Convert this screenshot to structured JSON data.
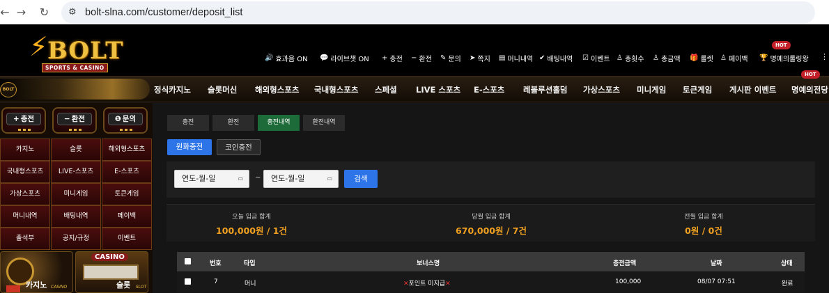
{
  "browser": {
    "url": "bolt-slna.com/customer/deposit_list"
  },
  "logo": {
    "name": "BOLT",
    "tagline": "SPORTS & CASINO"
  },
  "utility": [
    {
      "label": "효과음 ON",
      "icon": "speaker-icon",
      "glyph": "🔊"
    },
    {
      "label": "라이브챗 ON",
      "icon": "chat-icon",
      "glyph": "💬"
    },
    {
      "label": "충전",
      "icon": "plus-icon",
      "glyph": "+"
    },
    {
      "label": "환전",
      "icon": "minus-icon",
      "glyph": "−"
    },
    {
      "label": "문의",
      "icon": "edit-icon",
      "glyph": "✎"
    },
    {
      "label": "쪽지",
      "icon": "paper-plane-icon",
      "glyph": "➤"
    },
    {
      "label": "머니내역",
      "icon": "list-icon",
      "glyph": "▤"
    },
    {
      "label": "배팅내역",
      "icon": "check-icon",
      "glyph": "✔"
    },
    {
      "label": "이벤트",
      "icon": "calendar-icon",
      "glyph": "☑"
    },
    {
      "label": "총횟수",
      "icon": "user-icon",
      "glyph": "♙"
    },
    {
      "label": "총금액",
      "icon": "user-icon",
      "glyph": "♙"
    },
    {
      "label": "룰렛",
      "icon": "gift-icon",
      "glyph": "🎁"
    },
    {
      "label": "페이백",
      "icon": "user-icon",
      "glyph": "♙"
    },
    {
      "label": "명예의롤링왕",
      "icon": "trophy-icon",
      "glyph": "🏆"
    }
  ],
  "hot_badge": "HOT",
  "nav": [
    "정식카지노",
    "슬롯머신",
    "해외형스포츠",
    "국내형스포츠",
    "스페셜",
    "LIVE 스포츠",
    "E-스포츠",
    "레볼루션홀덤",
    "가상스포츠",
    "미니게임",
    "토큰게임",
    "게시판 이벤트",
    "명예의전당"
  ],
  "sidebar": {
    "buttons": [
      {
        "label": "충전",
        "glyph": "+"
      },
      {
        "label": "환전",
        "glyph": "−"
      },
      {
        "label": "문의",
        "glyph": "❶"
      }
    ],
    "grid": [
      "카지노",
      "슬롯",
      "해외형스포츠",
      "국내형스포츠",
      "LIVE-스포츠",
      "E-스포츠",
      "가상스포츠",
      "미니게임",
      "토큰게임",
      "머니내역",
      "배팅내역",
      "페이백",
      "출석부",
      "공지/규정",
      "이벤트"
    ],
    "banners": [
      {
        "title": "카지노",
        "sub": "CASINO"
      },
      {
        "title": "슬롯",
        "sub": "SLOT",
        "top": "CASINO"
      }
    ]
  },
  "tabs": [
    "충전",
    "환전",
    "충전내역",
    "환전내역"
  ],
  "active_tab": 2,
  "subtabs": [
    "원화충전",
    "코인충전"
  ],
  "filter": {
    "start": "연도-월-일",
    "end": "연도-월-일",
    "separator": "~",
    "search": "검색"
  },
  "stats": [
    {
      "label": "오늘 입금 합계",
      "value": "100,000원 / 1건"
    },
    {
      "label": "당월 입금 합계",
      "value": "670,000원 / 7건"
    },
    {
      "label": "전월 입금 합계",
      "value": "0원 / 0건"
    }
  ],
  "table": {
    "headers": [
      "번호",
      "타입",
      "보너스명",
      "충전금액",
      "날짜",
      "상태"
    ],
    "rows": [
      {
        "no": "7",
        "type": "머니",
        "bonus": "포인트 미지급",
        "amount": "100,000",
        "date": "08/07 07:51",
        "status": "완료"
      }
    ]
  }
}
